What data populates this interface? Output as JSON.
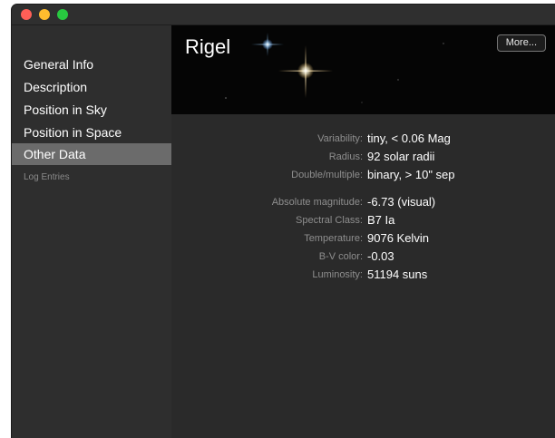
{
  "window": {
    "controls": [
      "close",
      "minimize",
      "zoom"
    ]
  },
  "sidebar": {
    "items": [
      {
        "label": "General Info"
      },
      {
        "label": "Description"
      },
      {
        "label": "Position in Sky"
      },
      {
        "label": "Position in Space"
      },
      {
        "label": "Other Data",
        "selected": true
      },
      {
        "label": "Log Entries"
      }
    ]
  },
  "header": {
    "title": "Rigel",
    "more_label": "More..."
  },
  "details": {
    "group1": [
      {
        "label": "Variability:",
        "value": "tiny, < 0.06 Mag"
      },
      {
        "label": "Radius:",
        "value": "92 solar radii"
      },
      {
        "label": "Double/multiple:",
        "value": "binary, > 10\" sep"
      }
    ],
    "group2": [
      {
        "label": "Absolute magnitude:",
        "value": "-6.73 (visual)"
      },
      {
        "label": "Spectral Class:",
        "value": "B7 Ia"
      },
      {
        "label": "Temperature:",
        "value": "9076 Kelvin"
      },
      {
        "label": "B-V color:",
        "value": "-0.03"
      },
      {
        "label": "Luminosity:",
        "value": "51194 suns"
      }
    ]
  }
}
